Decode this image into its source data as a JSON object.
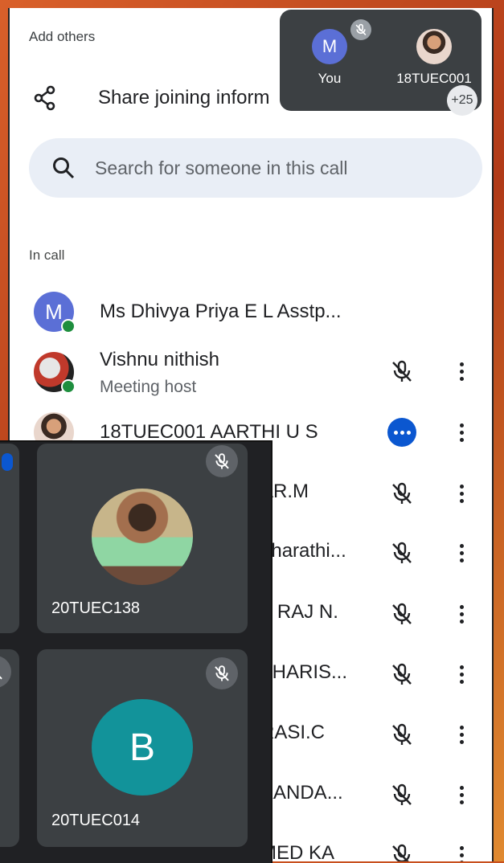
{
  "panel": {
    "add_others": "Add others",
    "share_label": "Share joining inform",
    "search_placeholder": "Search for someone in this call",
    "in_call_label": "In call"
  },
  "participants": [
    {
      "name": "Ms Dhivya Priya E L Asstp...",
      "initial": "M",
      "color": "#5b6fd6"
    },
    {
      "name": "Vishnu nithish",
      "subtitle": "Meeting host"
    },
    {
      "name": "18TUEC001 AARTHI U S"
    },
    {
      "name": "AR.M"
    },
    {
      "name": "bharathi..."
    },
    {
      "name": "T RAJ N."
    },
    {
      "name": "THARIS..."
    },
    {
      "name": "RASI.C"
    },
    {
      "name": "KANDA..."
    },
    {
      "name": "MED KA"
    }
  ],
  "pip": {
    "you_initial": "M",
    "you_label": "You",
    "other_label": "18TUEC001",
    "extra_count": "+25"
  },
  "grid": {
    "tile1_name": "20TUEC138",
    "tile2_name": "20TUEC014",
    "tile2_initial": "B"
  },
  "colors": {
    "accent_blue": "#0b57d0",
    "online_green": "#1e8e3e",
    "search_bg": "#e9eef6",
    "dark_tile": "#3c4043"
  }
}
